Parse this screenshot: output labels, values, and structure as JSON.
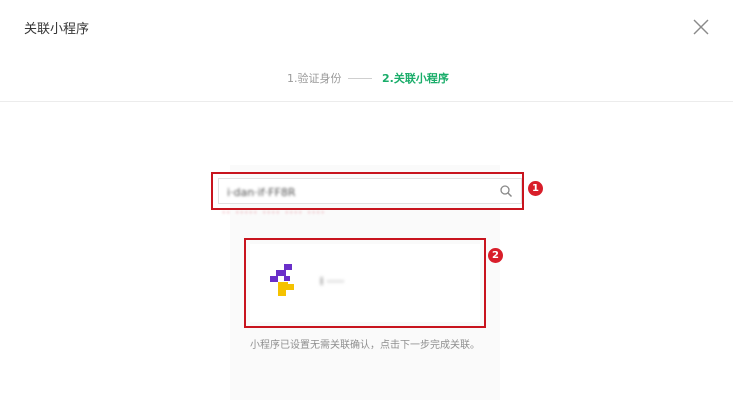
{
  "dialog": {
    "title": "关联小程序"
  },
  "icons": {
    "close": "close-icon",
    "search": "search-icon",
    "logo": "app-logo-icon"
  },
  "steps": {
    "step1_label": "1.验证身份",
    "step2_label": "2.关联小程序"
  },
  "search": {
    "value": "i·dan·if·FF8R",
    "hint": "·· ····· ···· ···· ····"
  },
  "result": {
    "app_name": "I ·····"
  },
  "annotations": {
    "badge1": "1",
    "badge2": "2"
  },
  "info": {
    "message": "小程序已设置无需关联确认，点击下一步完成关联。"
  },
  "colors": {
    "accent": "#1aad6a",
    "annotation": "#c8141e",
    "muted_text": "#8f8f8f"
  }
}
